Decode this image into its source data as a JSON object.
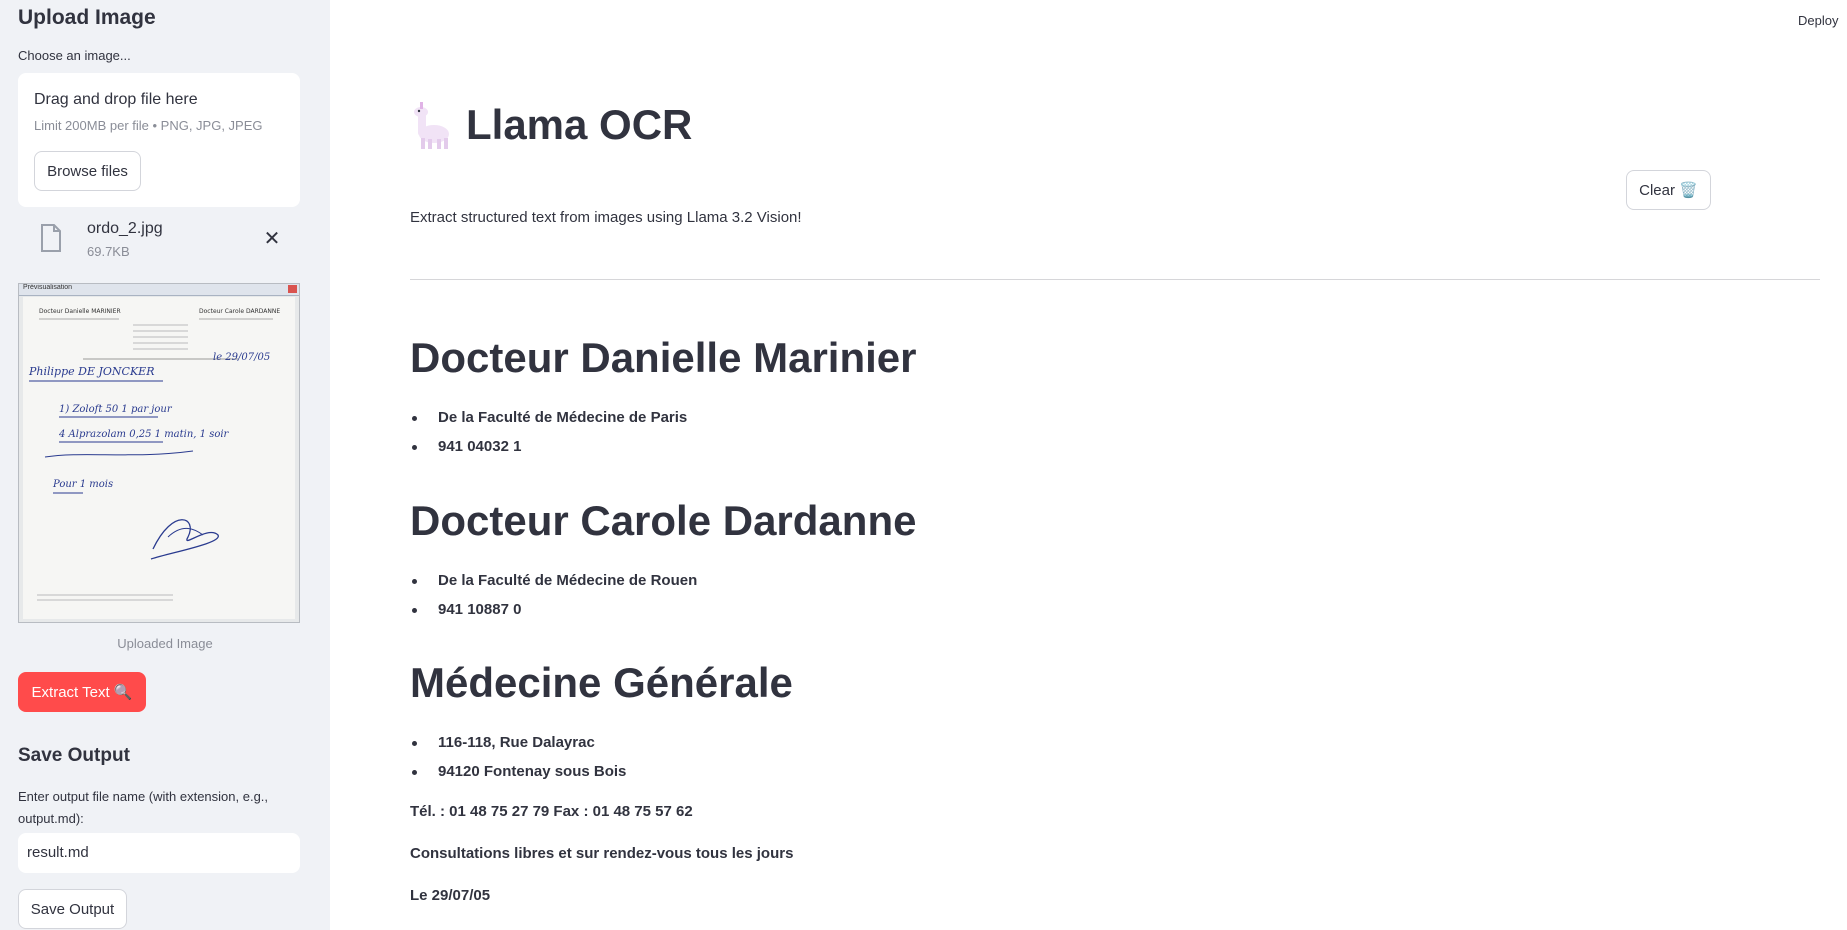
{
  "sidebar": {
    "title": "Upload Image",
    "choose_label": "Choose an image...",
    "dropzone": {
      "main_text": "Drag and drop file here",
      "sub_text": "Limit 200MB per file • PNG, JPG, JPEG",
      "browse_label": "Browse files"
    },
    "file": {
      "name": "ordo_2.jpg",
      "size": "69.7KB"
    },
    "preview": {
      "caption": "Uploaded Image",
      "window_title": "Prévisualisation",
      "doctor_left": "Docteur Danielle MARINIER",
      "doctor_right": "Docteur Carole DARDANNE",
      "patient": "Philippe DE JONCKER",
      "date": "le 29/07/05",
      "line1": "1) Zoloft 50  1 par jour",
      "line2": "4 Alprazolam 0,25  1 matin, 1 soir",
      "line3": "Pour 1 mois"
    },
    "extract_label": "Extract Text 🔍",
    "save_title": "Save Output",
    "filename_label": "Enter output file name (with extension, e.g., output.md):",
    "filename_value": "result.md",
    "save_label": "Save Output"
  },
  "header": {
    "deploy_label": "Deploy"
  },
  "main": {
    "title": "Llama OCR",
    "clear_label": "Clear 🗑️",
    "subtitle": "Extract structured text from images using Llama 3.2 Vision!",
    "result": {
      "h1_a": "Docteur Danielle Marinier",
      "list_a": [
        "De la Faculté de Médecine de Paris",
        "941 04032 1"
      ],
      "h1_b": "Docteur Carole Dardanne",
      "list_b": [
        "De la Faculté de Médecine de Rouen",
        "941 10887 0"
      ],
      "h1_c": "Médecine Générale",
      "list_c": [
        "116-118, Rue Dalayrac",
        "94120 Fontenay sous Bois"
      ],
      "phone": "Tél. : 01 48 75 27 79 Fax : 01 48 75 57 62",
      "consult": "Consultations libres et sur rendez-vous tous les jours",
      "date": "Le 29/07/05"
    }
  },
  "colors": {
    "primary": "#ff4b4b",
    "sidebar_bg": "#f0f2f6",
    "text": "#31333f"
  },
  "icons": {
    "file": "file-icon",
    "remove": "close-icon",
    "title_emoji": "llama-icon"
  }
}
